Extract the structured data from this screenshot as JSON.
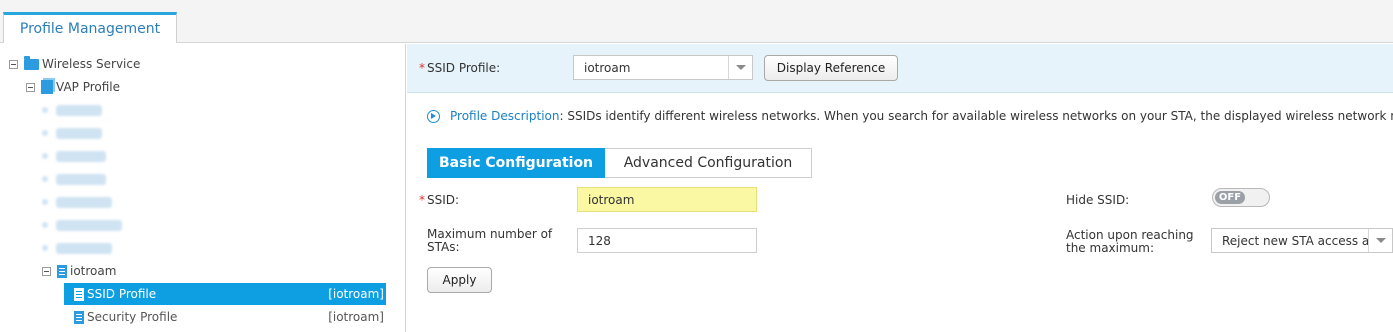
{
  "top_tab": {
    "label": "Profile Management"
  },
  "tree": {
    "root_label": "Wireless Service",
    "vap_label": "VAP Profile",
    "profile_label": "iotroam",
    "selected_item": {
      "label": "SSID Profile",
      "ref": "[iotroam]"
    },
    "next_item": {
      "label": "Security Profile",
      "ref": "[iotroam]"
    }
  },
  "ssid_bar": {
    "label": "SSID Profile:",
    "required_mark": "*",
    "selected_value": "iotroam",
    "button": "Display Reference"
  },
  "description": {
    "key": "Profile Description",
    "text": ": SSIDs identify different wireless networks. When you search for available wireless networks on your STA, the displayed wireless network names are"
  },
  "tabs": [
    {
      "label": "Basic Configuration",
      "active": true
    },
    {
      "label": "Advanced Configuration",
      "active": false
    }
  ],
  "form": {
    "ssid_label": "SSID:",
    "ssid_required": "*",
    "ssid_value": "iotroam",
    "max_sta_label_1": "Maximum number of",
    "max_sta_label_2": "STAs:",
    "max_sta_value": "128",
    "hide_ssid_label": "Hide SSID:",
    "hide_ssid_state": "OFF",
    "action_label_1": "Action upon reaching",
    "action_label_2": "the maximum:",
    "action_value": "Reject new STA access a",
    "apply_label": "Apply"
  },
  "colors": {
    "accent": "#0e9ee2",
    "highlight": "#fbf8a4",
    "required": "#e0302e"
  }
}
